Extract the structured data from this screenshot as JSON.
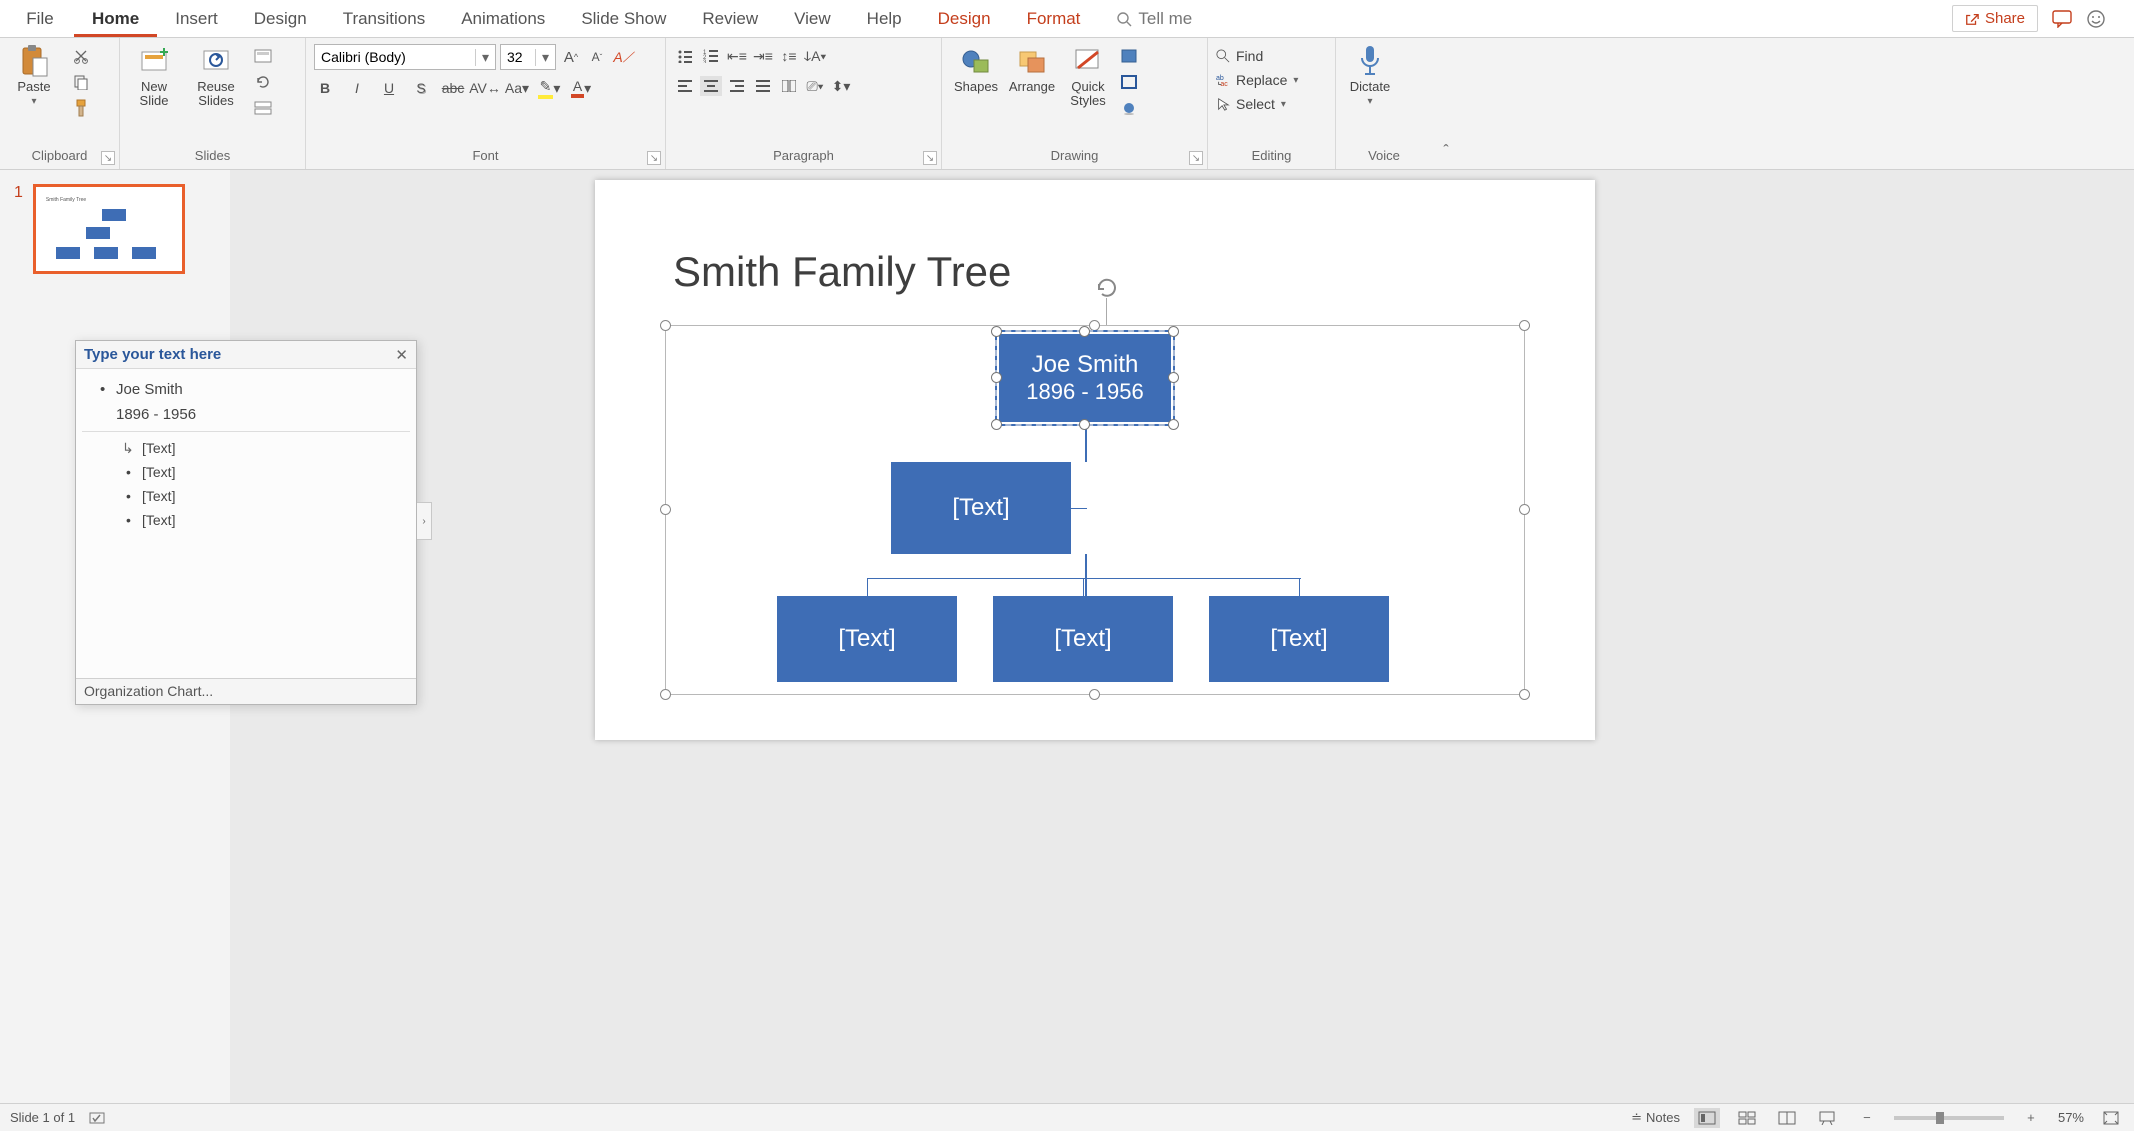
{
  "menu": {
    "file": "File",
    "tabs": [
      "Home",
      "Insert",
      "Design",
      "Transitions",
      "Animations",
      "Slide Show",
      "Review",
      "View",
      "Help"
    ],
    "tool_tabs": [
      "Design",
      "Format"
    ],
    "active": "Home",
    "tellme": "Tell me",
    "share": "Share"
  },
  "ribbon": {
    "clipboard": {
      "label": "Clipboard",
      "paste": "Paste"
    },
    "slides": {
      "label": "Slides",
      "new": "New\nSlide",
      "reuse": "Reuse\nSlides"
    },
    "font": {
      "label": "Font",
      "name": "Calibri (Body)",
      "size": "32"
    },
    "paragraph": {
      "label": "Paragraph"
    },
    "drawing": {
      "label": "Drawing",
      "shapes": "Shapes",
      "arrange": "Arrange",
      "quick": "Quick\nStyles"
    },
    "editing": {
      "label": "Editing",
      "find": "Find",
      "replace": "Replace",
      "select": "Select"
    },
    "voice": {
      "label": "Voice",
      "dictate": "Dictate"
    }
  },
  "thumb": {
    "index": "1"
  },
  "slide": {
    "title": "Smith Family Tree",
    "root_name": "Joe Smith",
    "root_dates": "1896 - 1956",
    "placeholder": "[Text]"
  },
  "textpane": {
    "title": "Type your text here",
    "row1": "Joe Smith",
    "row1b": "1896 - 1956",
    "ph": "[Text]",
    "footer": "Organization Chart..."
  },
  "status": {
    "slide": "Slide 1 of 1",
    "notes": "Notes",
    "zoom": "57%"
  }
}
